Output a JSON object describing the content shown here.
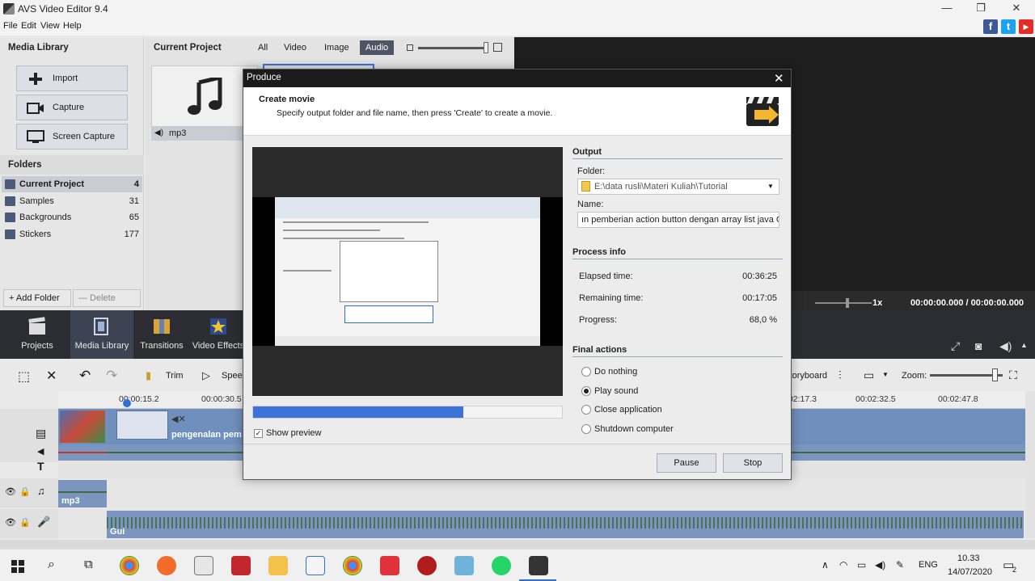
{
  "app": {
    "title": "AVS Video Editor 9.4"
  },
  "menu": [
    "File",
    "Edit",
    "View",
    "Help"
  ],
  "social": {
    "facebook": "f",
    "twitter": "t",
    "youtube": "▶"
  },
  "library": {
    "title": "Media Library",
    "buttons": [
      "Import",
      "Capture",
      "Screen Capture"
    ],
    "folders_title": "Folders",
    "folders": [
      {
        "name": "Current Project",
        "count": "4"
      },
      {
        "name": "Samples",
        "count": "31"
      },
      {
        "name": "Backgrounds",
        "count": "65"
      },
      {
        "name": "Stickers",
        "count": "177"
      }
    ],
    "add_folder": "+ Add Folder",
    "delete_folder": "— Delete Folder"
  },
  "project": {
    "title": "Current Project",
    "filters": [
      "All",
      "Video",
      "Image",
      "Audio"
    ],
    "active_filter": "Audio",
    "item_label": "mp3"
  },
  "player": {
    "speed": "1x",
    "time": "00:00:00.000 / 00:00:00.000"
  },
  "main_toolbar": [
    "Projects",
    "Media Library",
    "Transitions",
    "Video Effects"
  ],
  "edit_toolbar": {
    "trim": "Trim",
    "speed": "Speed",
    "storyboard": "Storyboard",
    "zoom": "Zoom:"
  },
  "timeline": {
    "ticks": [
      "00:00:15.2",
      "00:00:30.5",
      "00:02:17.3",
      "00:02:32.5",
      "00:02:47.8"
    ],
    "clip_label": "pengenalan pem",
    "audio_clip": "mp3",
    "voice_clip": "Gui"
  },
  "dialog": {
    "title": "Produce",
    "heading": "Create movie",
    "subheading": "Specify output folder and file name, then press 'Create' to create a movie.",
    "output_title": "Output",
    "folder_label": "Folder:",
    "folder_value": "E:\\data rusli\\Materi Kuliah\\Tutorial",
    "name_label": "Name:",
    "name_value": "ın pemberian action button dengan array list java GUI",
    "process_title": "Process info",
    "elapsed_label": "Elapsed time:",
    "elapsed_value": "00:36:25",
    "remaining_label": "Remaining time:",
    "remaining_value": "00:17:05",
    "progress_label": "Progress:",
    "progress_value": "68,0 %",
    "progress_fraction": 0.68,
    "final_title": "Final actions",
    "final_options": [
      "Do nothing",
      "Play sound",
      "Close application",
      "Shutdown computer"
    ],
    "final_selected": "Play sound",
    "show_preview": "Show preview",
    "pause": "Pause",
    "stop": "Stop"
  },
  "taskbar": {
    "lang": "ENG",
    "time": "10.33",
    "date": "14/07/2020",
    "notif_count": "2"
  },
  "colors": {
    "accent": "#3b73d9",
    "titlebar": "#1b1b1b",
    "darkbar": "#2b2d33"
  }
}
